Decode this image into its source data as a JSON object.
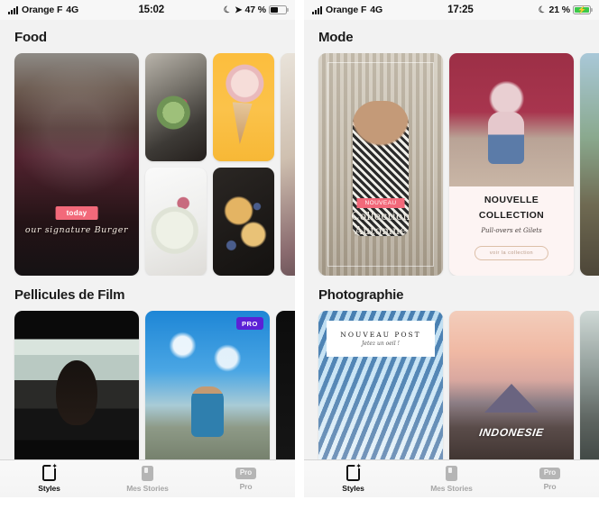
{
  "app": {
    "pro_badge_label": "PRO"
  },
  "phones": [
    {
      "id": "left",
      "statusbar": {
        "carrier": "Orange F",
        "network": "4G",
        "time": "15:02",
        "battery_percent": "47 %",
        "charging": false,
        "signal_icon": "signal-bars-icon",
        "moon_icon": "moon-icon",
        "location_icon": "location-arrow-icon",
        "battery_icon": "battery-icon"
      },
      "sections": [
        {
          "title": "Food",
          "cards": [
            {
              "name": "burger-story-card",
              "style": "ph-burger",
              "badge": "today",
              "script": "our signature Burger"
            },
            {
              "name": "salad-card",
              "style": "ph-salad"
            },
            {
              "name": "icecream-card",
              "style": "ph-icecream"
            },
            {
              "name": "bowl-card",
              "style": "ph-bowl"
            },
            {
              "name": "toast-card",
              "style": "ph-toast"
            },
            {
              "name": "side-card",
              "style": "ph-side"
            }
          ]
        },
        {
          "title": "Pellicules de Film",
          "cards": [
            {
              "name": "film-dark-card",
              "style": "ph-filmdark"
            },
            {
              "name": "film-blue-card",
              "style": "ph-filmblue",
              "pro": true
            },
            {
              "name": "film-black-card",
              "style": "ph-filmblack"
            }
          ]
        }
      ],
      "tabs": [
        {
          "label": "Styles",
          "icon": "styles-icon",
          "active": true
        },
        {
          "label": "Mes Stories",
          "icon": "stories-icon",
          "active": false
        },
        {
          "label": "Pro",
          "icon": "pro-badge-icon",
          "badge": "Pro",
          "active": false
        }
      ]
    },
    {
      "id": "right",
      "statusbar": {
        "carrier": "Orange F",
        "network": "4G",
        "time": "17:25",
        "battery_percent": "21 %",
        "charging": true,
        "signal_icon": "signal-bars-icon",
        "moon_icon": "moon-icon",
        "location_icon": "",
        "battery_icon": "battery-charging-icon"
      },
      "sections": [
        {
          "title": "Mode",
          "cards": [
            {
              "name": "collection-automne-card",
              "style": "ph-mode1",
              "badge": "NOUVEAU",
              "title1": "Collection",
              "title2": "Automne"
            },
            {
              "name": "nouvelle-collection-card",
              "style": "ph-mode2",
              "title1": "NOUVELLE",
              "title2": "COLLECTION",
              "subtitle": "Pull-overs et Gilets",
              "button": "voir la collection"
            },
            {
              "name": "mode-third-card",
              "style": "ph-mode3"
            }
          ]
        },
        {
          "title": "Photographie",
          "cards": [
            {
              "name": "nouveau-post-card",
              "style": "ph-photo1",
              "title1": "NOUVEAU POST",
              "title2": "Jetez un oeil !"
            },
            {
              "name": "indonesie-card",
              "style": "ph-photo2",
              "title1": "INDONESIE"
            },
            {
              "name": "photo-third-card",
              "style": "ph-photo3"
            }
          ]
        }
      ],
      "tabs": [
        {
          "label": "Styles",
          "icon": "styles-icon",
          "active": true
        },
        {
          "label": "Mes Stories",
          "icon": "stories-icon",
          "active": false
        },
        {
          "label": "Pro",
          "icon": "pro-badge-icon",
          "badge": "Pro",
          "active": false
        }
      ]
    }
  ],
  "colors": {
    "accent_pink": "#f2697a",
    "pro_purple": "#5b21d6",
    "screen_bg": "#f2f2f2",
    "text_primary": "#1b1b1b",
    "text_dim": "#a6a6a6",
    "battery_green": "#3cc84a"
  }
}
